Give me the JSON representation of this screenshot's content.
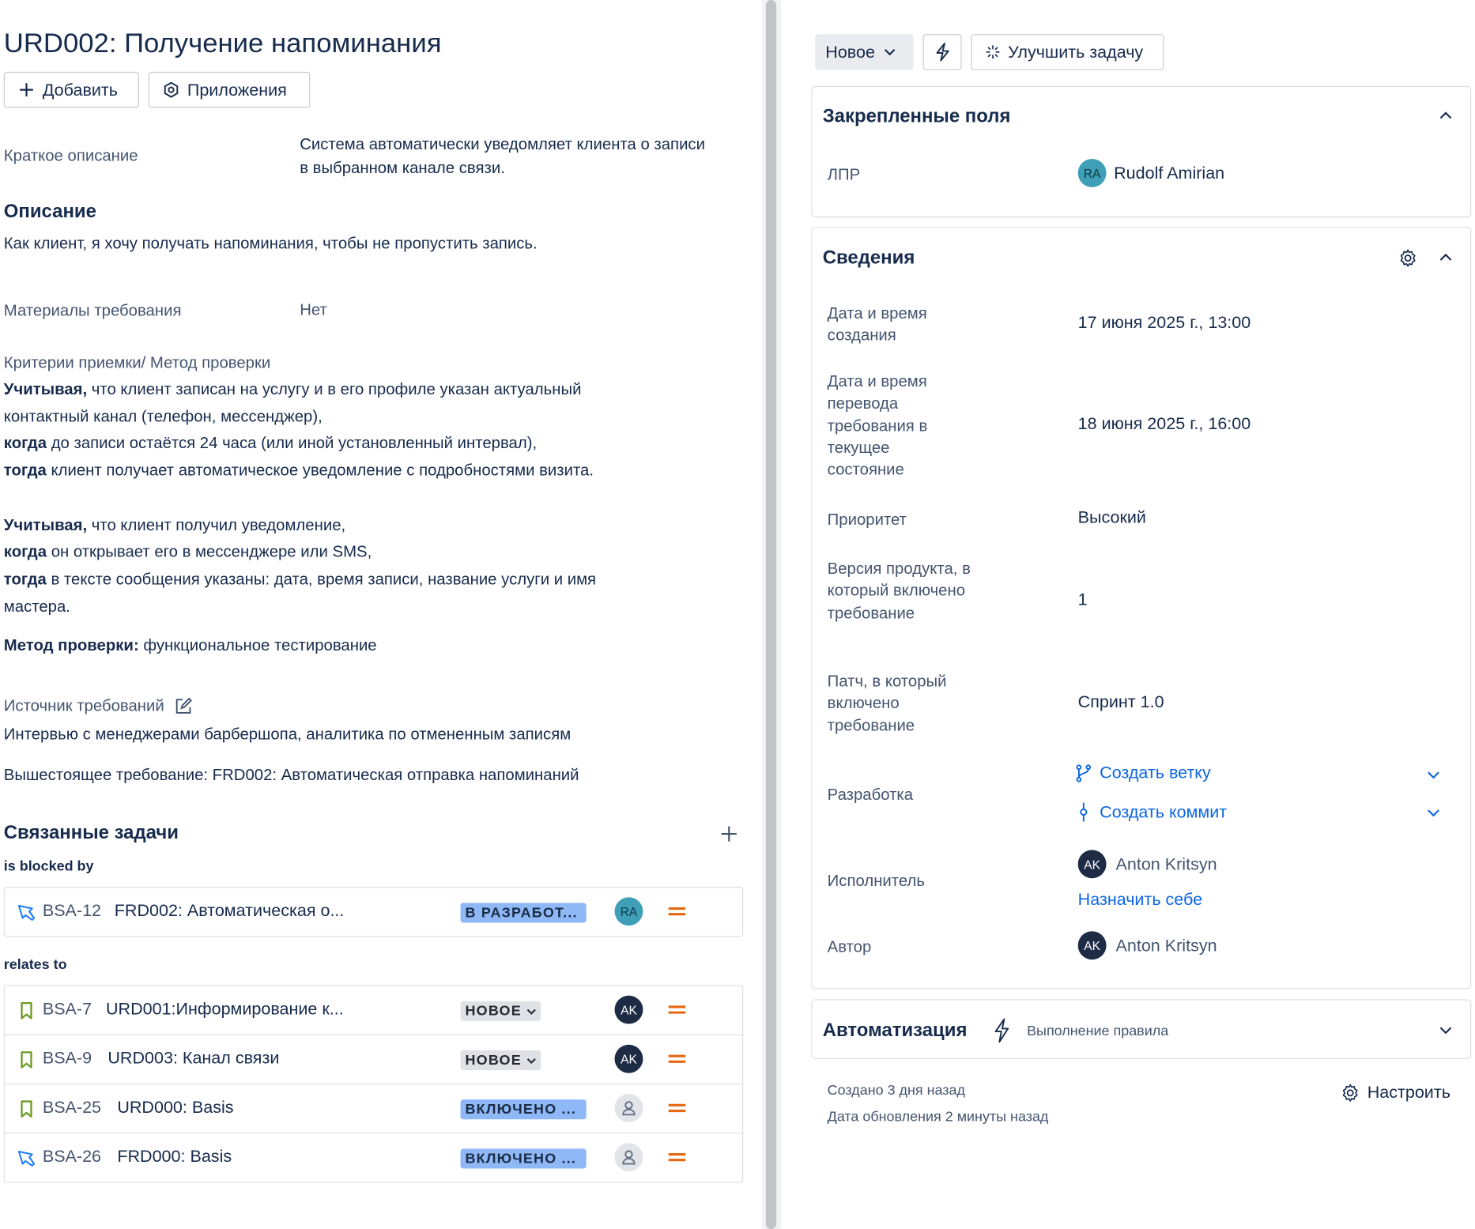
{
  "issue": {
    "title": "URD002: Получение напоминания",
    "add_label": "Добавить",
    "apps_label": "Приложения"
  },
  "short_description": {
    "label": "Краткое описание",
    "value": "Система автоматически уведомляет клиента о записи в выбранном канале связи."
  },
  "description": {
    "heading": "Описание",
    "text": "Как клиент, я хочу получать напоминания, чтобы не пропустить запись."
  },
  "materials": {
    "label": "Материалы требования",
    "value": "Нет"
  },
  "criteria": {
    "heading": "Критерии приемки/ Метод проверки",
    "l1_bold": "Учитывая,",
    "l1": " что клиент записан на услугу и в его профиле указан актуальный",
    "l2": "контактный канал (телефон, мессенджер),",
    "l3_bold": "когда",
    "l3": " до записи остаётся 24 часа (или иной установленный интервал),",
    "l4_bold": "тогда",
    "l4": " клиент получает автоматическое уведомление с подробностями визита.",
    "l5_bold": "Учитывая,",
    "l5": " что клиент получил уведомление,",
    "l6_bold": "когда",
    "l6": " он открывает его в мессенджере или SMS,",
    "l7_bold": "тогда",
    "l7": " в тексте сообщения указаны: дата, время записи, название услуги и имя",
    "l8": "мастера.",
    "method_bold": "Метод проверки:",
    "method": " функциональное тестирование"
  },
  "source": {
    "label": "Источник требований",
    "text": "Интервью с менеджерами барбершопа, аналитика по отмененным записям"
  },
  "parent": "Вышестоящее требование: FRD002: Автоматическая отправка напоминаний",
  "linked": {
    "heading": "Связанные задачи",
    "blocked_label": "is blocked by",
    "relates_label": "relates to",
    "blocked": [
      {
        "type_icon": "subtask-pen-icon",
        "key": "BSA-12",
        "summary": "FRD002: Автоматическая о...",
        "status": "В РАЗРАБОТ...",
        "assignee": "RA"
      }
    ],
    "relates": [
      {
        "type_icon": "bookmark-icon",
        "key": "BSA-7",
        "summary": "URD001:Информирование к...",
        "status": "НОВОЕ",
        "assignee": "AK"
      },
      {
        "type_icon": "bookmark-icon",
        "key": "BSA-9",
        "summary": "URD003: Канал связи",
        "status": "НОВОЕ",
        "assignee": "AK"
      },
      {
        "type_icon": "bookmark-icon",
        "key": "BSA-25",
        "summary": "URD000: Basis",
        "status": "ВКЛЮЧЕНО ...",
        "assignee": ""
      },
      {
        "type_icon": "subtask-pen-icon",
        "key": "BSA-26",
        "summary": "FRD000: Basis",
        "status": "ВКЛЮЧЕНО ...",
        "assignee": ""
      }
    ]
  },
  "toolbar": {
    "status": "Новое",
    "improve": "Улучшить задачу"
  },
  "pinned": {
    "heading": "Закрепленные поля",
    "lpr_label": "ЛПР",
    "lpr_initials": "RA",
    "lpr_name": "Rudolf Amirian"
  },
  "details": {
    "heading": "Сведения",
    "created_label": "Дата и время создания",
    "created_value": "17 июня 2025 г., 13:00",
    "transition_label": "Дата и время перевода требования в текущее состояние",
    "transition_value": "18 июня 2025 г., 16:00",
    "priority_label": "Приоритет",
    "priority_value": "Высокий",
    "version_label": "Версия продукта, в который включено требование",
    "version_value": "1",
    "patch_label": "Патч, в который включено требование",
    "patch_value": "Спринт 1.0",
    "dev_label": "Разработка",
    "create_branch": "Создать ветку",
    "create_commit": "Создать коммит",
    "assignee_label": "Исполнитель",
    "assignee_initials": "AK",
    "assignee_name": "Anton Kritsyn",
    "assign_self": "Назначить себе",
    "author_label": "Автор",
    "author_initials": "AK",
    "author_name": "Anton Kritsyn"
  },
  "automation": {
    "heading": "Автоматизация",
    "rule": "Выполнение правила"
  },
  "footer": {
    "created": "Создано 3 дня назад",
    "updated": "Дата обновления 2 минуты назад",
    "configure": "Настроить"
  },
  "colors": {
    "link": "#0c66e4",
    "priority": "#e56910",
    "status_blue": "#8fb8f6",
    "status_grey": "#dfe1e6"
  }
}
